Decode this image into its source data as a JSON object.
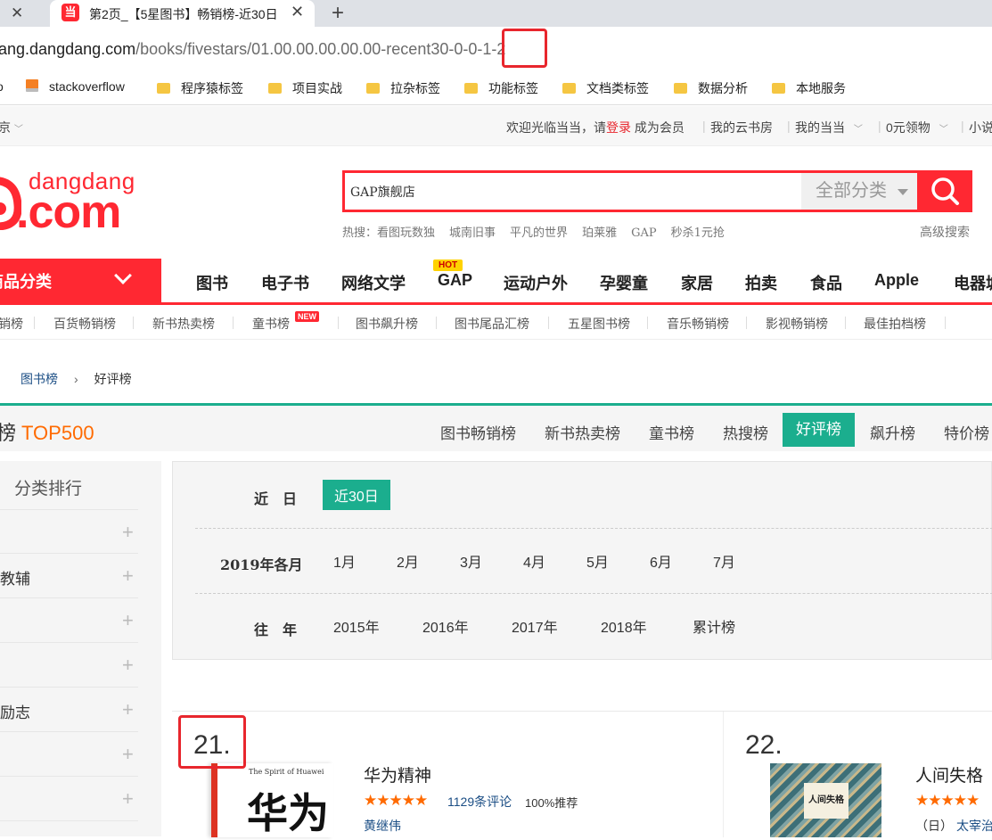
{
  "browser": {
    "tab_title": "第2页_【5星图书】畅销榜-近30日",
    "favicon_glyph": "当",
    "url_host": "ang.dangdang.com",
    "url_path": "/books/fivestars/01.00.00.00.00.00-recent30-0-0-1-2",
    "bookmarks": [
      "o",
      "stackoverflow",
      "程序猿标签",
      "项目实战",
      "拉杂标签",
      "功能标签",
      "文档类标签",
      "数据分析",
      "本地服务"
    ]
  },
  "topbar": {
    "location": "京",
    "welcome": "欢迎光临当当，请",
    "login": "登录",
    "register": "成为会员",
    "items": [
      "我的云书房",
      "我的当当",
      "0元领物",
      "小说"
    ]
  },
  "logo": {
    "small": "dangdang",
    "big": ".com"
  },
  "search": {
    "value": "GAP旗舰店",
    "category": "全部分类",
    "hot_label": "热搜：",
    "hot_terms": [
      "看图玩数独",
      "城南旧事",
      "平凡的世界",
      "珀莱雅",
      "GAP",
      "秒杀1元抢"
    ],
    "advanced": "高级搜索"
  },
  "nav": {
    "all_categories": "商品分类",
    "items": [
      "图书",
      "电子书",
      "网络文学",
      "GAP",
      "运动户外",
      "孕婴童",
      "家居",
      "拍卖",
      "食品",
      "Apple",
      "电器城"
    ],
    "hot_badge": "HOT"
  },
  "subnav": {
    "items": [
      "销榜",
      "百货畅销榜",
      "新书热卖榜",
      "童书榜",
      "图书飙升榜",
      "图书尾品汇榜",
      "五星图书榜",
      "音乐畅销榜",
      "影视畅销榜",
      "最佳拍档榜"
    ],
    "new_badge": "NEW"
  },
  "breadcrumb": {
    "parent": "图书榜",
    "current": "好评榜"
  },
  "ranking": {
    "title": "榜",
    "top": "TOP500",
    "tabs": [
      "图书畅销榜",
      "新书热卖榜",
      "童书榜",
      "热搜榜",
      "好评榜",
      "飙升榜",
      "特价榜"
    ],
    "active_tab": "好评榜"
  },
  "sidebar": {
    "title": "分类排行",
    "rows": [
      "",
      "教辅",
      "",
      "",
      "励志",
      "",
      ""
    ]
  },
  "filter": {
    "recent_label": "近　日",
    "recent_option": "近30日",
    "monthly_label": "2019年各月",
    "months": [
      "1月",
      "2月",
      "3月",
      "4月",
      "5月",
      "6月",
      "7月"
    ],
    "yearly_label": "往　年",
    "years": [
      "2015年",
      "2016年",
      "2017年",
      "2018年",
      "累计榜"
    ]
  },
  "products": [
    {
      "rank": "21.",
      "title": "华为精神",
      "cover_title": "华为",
      "cover_sub": "The Spirit of Huawei",
      "stars": "★★★★★",
      "reviews": "1129条评论",
      "recommend": "100%推荐",
      "author": "黄继伟"
    },
    {
      "rank": "22.",
      "title": "人间失格",
      "cover_title": "人间失格",
      "stars": "★★★★★",
      "author_prefix": "（日）",
      "author": "太宰治"
    }
  ],
  "colors": {
    "brand": "#ff2832",
    "accent": "#1bae8e",
    "highlight_box": "#e8262d"
  }
}
